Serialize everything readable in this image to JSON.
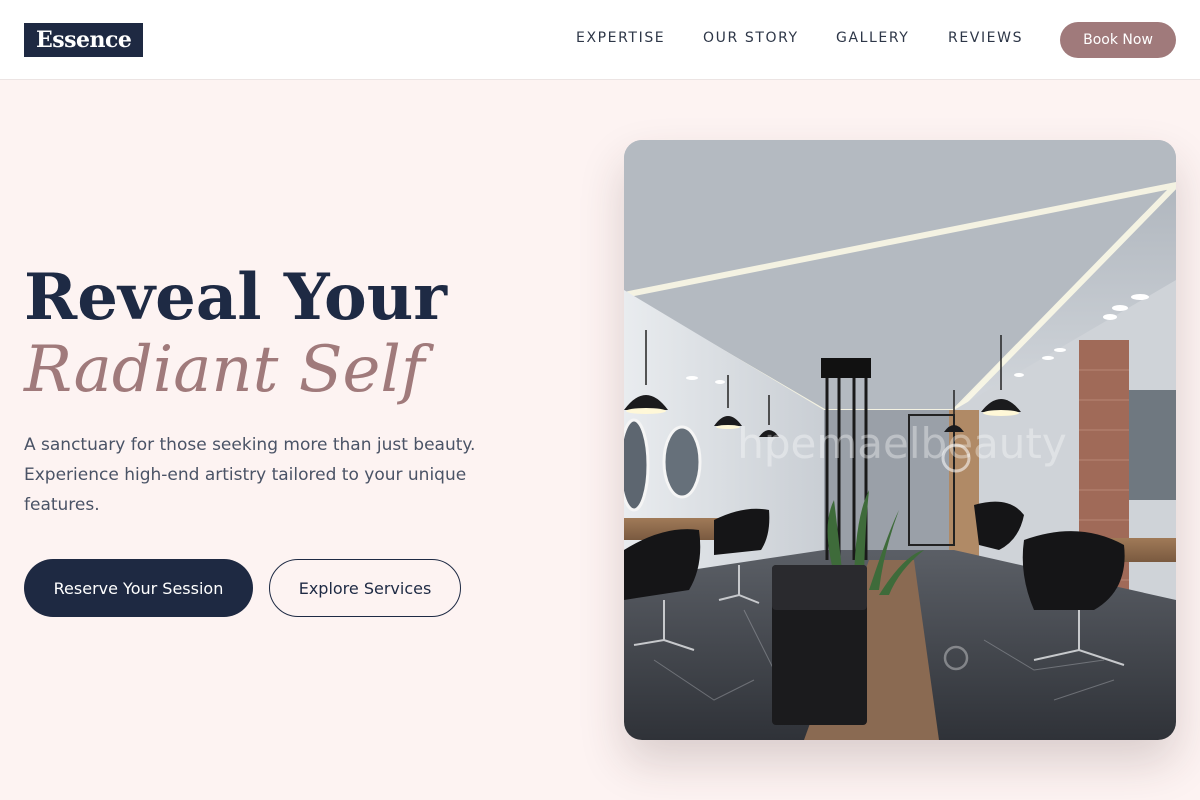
{
  "brand": {
    "logo_text": "Essence"
  },
  "nav": {
    "links": [
      "EXPERTISE",
      "OUR STORY",
      "GALLERY",
      "REVIEWS"
    ],
    "cta_label": "Book Now"
  },
  "hero": {
    "headline": "Reveal Your",
    "headline_accent": "Radiant Self",
    "tagline": "A sanctuary for those seeking more than just beauty. Experience high-end artistry tailored to your unique features.",
    "primary_button": "Reserve Your Session",
    "secondary_button": "Explore Services",
    "image_watermark": "hpemaelbeauty"
  },
  "colors": {
    "navy": "#1e2942",
    "rose": "#a07a7b",
    "background": "#fdf3f2"
  }
}
